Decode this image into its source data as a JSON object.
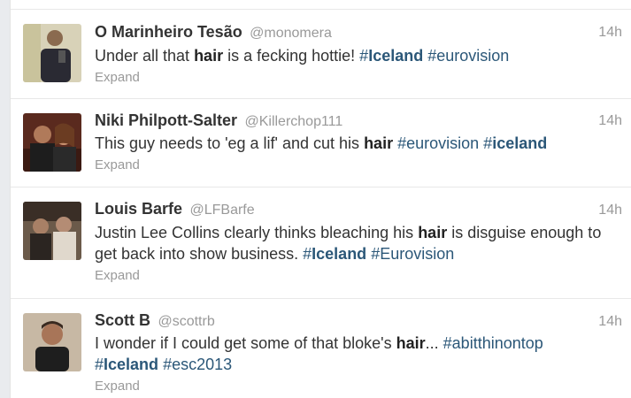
{
  "tweets": [
    {
      "fullname": "O Marinheiro Tesão",
      "username": "@monomera",
      "time": "14h",
      "expand": "Expand",
      "text_parts": [
        "Under all that ",
        "hair",
        " is a fecking hottie! ",
        "#",
        "Iceland",
        " ",
        "#eurovision"
      ]
    },
    {
      "fullname": "Niki Philpott-Salter",
      "username": "@Killerchop111",
      "time": "14h",
      "expand": "Expand",
      "text_parts": [
        "This guy needs to 'eg a lif' and cut his ",
        "hair",
        " ",
        "#eurovision",
        " ",
        "#",
        "iceland"
      ]
    },
    {
      "fullname": "Louis Barfe",
      "username": "@LFBarfe",
      "time": "14h",
      "expand": "Expand",
      "text_parts": [
        "Justin Lee Collins clearly thinks bleaching his ",
        "hair",
        " is disguise enough to get back into show business. ",
        "#",
        "Iceland",
        " ",
        "#Eurovision"
      ]
    },
    {
      "fullname": "Scott B",
      "username": "@scottrb",
      "time": "14h",
      "expand": "Expand",
      "text_parts": [
        "I wonder if I could get some of that bloke's ",
        "hair",
        "... ",
        "#abitthinontop",
        " ",
        "#",
        "Iceland",
        " ",
        "#esc2013"
      ]
    }
  ],
  "colors": {
    "hashtag": "#2b5778",
    "meta": "#999999",
    "text": "#333333"
  }
}
